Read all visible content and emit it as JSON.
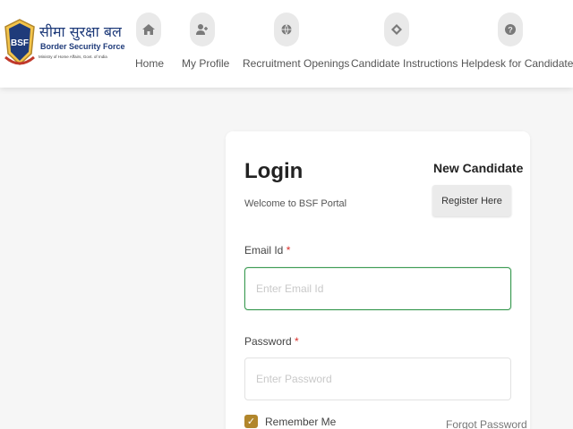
{
  "brand": {
    "hindi_name": "सीमा सुरक्षा बल",
    "english_name": "Border Security Force",
    "subtitle": "Ministry of Home Affairs, Govt. of India",
    "emblem_text": "BSF"
  },
  "nav": {
    "items": [
      {
        "label": "Home",
        "icon": "home-icon"
      },
      {
        "label": "My Profile",
        "icon": "user-plus-icon"
      },
      {
        "label": "Recruitment Openings",
        "icon": "globe-icon"
      },
      {
        "label": "Candidate Instructions",
        "icon": "diamond-icon"
      },
      {
        "label": "Helpdesk for Candidates",
        "icon": "help-icon"
      }
    ]
  },
  "login": {
    "title": "Login",
    "welcome": "Welcome to BSF Portal",
    "new_candidate": "New Candidate",
    "register_label": "Register Here",
    "email_label": "Email Id",
    "email_placeholder": "Enter Email Id",
    "email_value": "",
    "password_label": "Password",
    "password_placeholder": "Enter Password",
    "password_value": "",
    "required_mark": "*",
    "remember_label": "Remember Me",
    "remember_checked": true,
    "forgot_label": "Forgot Password"
  },
  "colors": {
    "accent_green": "#3a9a52",
    "checkbox_gold": "#b1862b",
    "required_red": "#d9302c"
  }
}
